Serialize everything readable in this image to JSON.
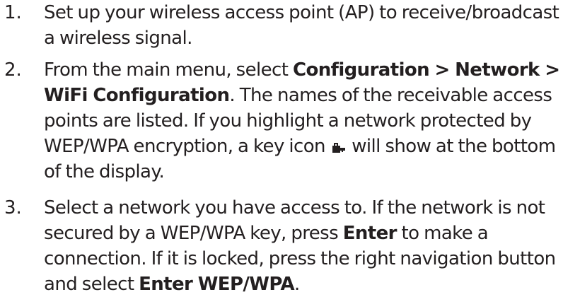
{
  "steps": [
    {
      "number": "1.",
      "text": "Set up your wireless access point (AP) to receive/broadcast a wireless signal."
    },
    {
      "number": "2.",
      "intro": "From the main menu, select ",
      "menu_path": "Configuration > Network > WiFi Configuration",
      "after_path": ". The names of the receivable access points are listed. If you highlight a network protected by WEP/WPA encryption, a key icon ",
      "icon": "key-icon",
      "after_icon": " will show at the bottom of the display."
    },
    {
      "number": "3.",
      "intro": "Select a network you have access to. If the network is not secured by a WEP/WPA key, press ",
      "enter_label": "Enter",
      "middle": " to make a connection. If it is locked, press the right navigation button and select ",
      "enter_wep_label": "Enter WEP/WPA",
      "end": "."
    }
  ]
}
